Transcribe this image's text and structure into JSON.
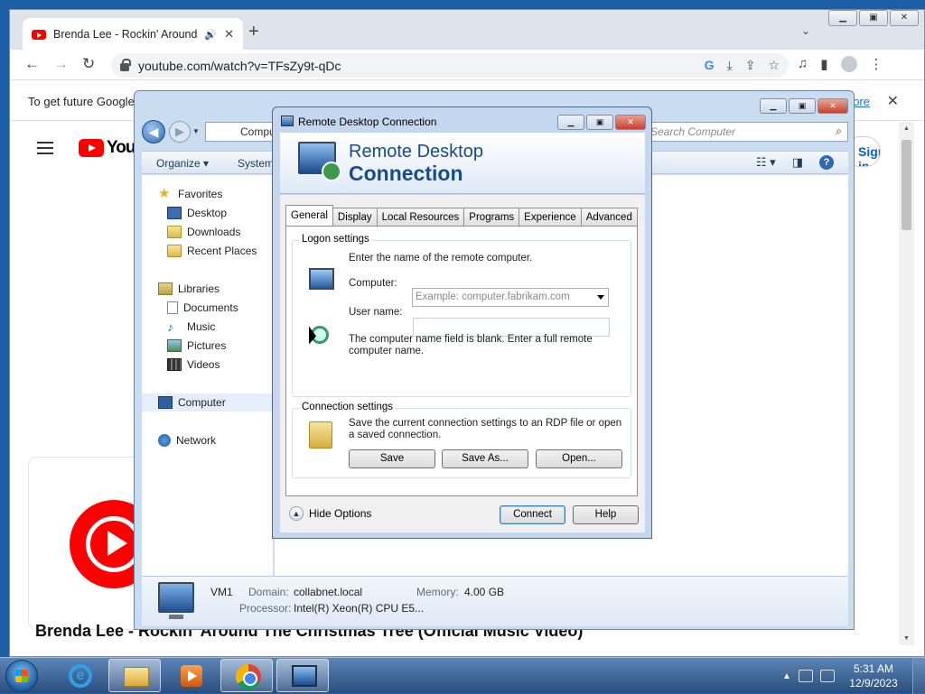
{
  "chrome": {
    "tab_title": "Brenda Lee - Rockin' Around The Christmas Tree",
    "url": "youtube.com/watch?v=TFsZy9t-qDc",
    "info_text": "To get future Google",
    "info_link": "ore",
    "new_tab": "+",
    "youtube_logo": "YouTube",
    "sign_in": "Sign in",
    "video_title": "Brenda Lee - Rockin' Around The Christmas Tree (Official Music Video)"
  },
  "explorer": {
    "address": "Computer",
    "search_placeholder": "Search Computer",
    "commands": {
      "organize": "Organize ▾",
      "system": "System properties"
    },
    "nav": {
      "favorites": "Favorites",
      "desktop": "Desktop",
      "downloads": "Downloads",
      "recent": "Recent Places",
      "libraries": "Libraries",
      "documents": "Documents",
      "music": "Music",
      "pictures": "Pictures",
      "videos": "Videos",
      "computer": "Computer",
      "network": "Network"
    },
    "details": {
      "name": "VM1",
      "domain_label": "Domain:",
      "domain": "collabnet.local",
      "memory_label": "Memory:",
      "memory": "4.00 GB",
      "processor_label": "Processor:",
      "processor": "Intel(R) Xeon(R) CPU E5..."
    }
  },
  "rdc": {
    "title": "Remote Desktop Connection",
    "banner_line1": "Remote Desktop",
    "banner_line2": "Connection",
    "tabs": [
      "General",
      "Display",
      "Local Resources",
      "Programs",
      "Experience",
      "Advanced"
    ],
    "active_tab": "General",
    "logon_settings": "Logon settings",
    "enter_name": "Enter the name of the remote computer.",
    "computer_label": "Computer:",
    "computer_placeholder": "Example: computer.fabrikam.com",
    "username_label": "User name:",
    "username_value": "",
    "blank_msg": "The computer name field is blank. Enter a full remote computer name.",
    "connection_settings": "Connection settings",
    "save_msg": "Save the current connection settings to an RDP file or open a saved connection.",
    "save": "Save",
    "save_as": "Save As...",
    "open": "Open...",
    "hide_options": "Hide Options",
    "connect": "Connect",
    "help": "Help"
  },
  "taskbar": {
    "time": "5:31 AM",
    "date": "12/9/2023"
  }
}
